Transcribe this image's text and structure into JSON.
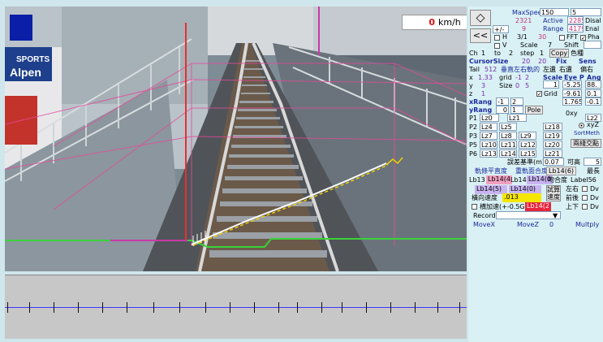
{
  "speed": {
    "value": "0",
    "unit": "km/h"
  },
  "signs": {
    "sports": "SPORTS",
    "alpen": "Alpen"
  },
  "panel": {
    "diamond_symbol": "◇",
    "rewind_symbol": "<<",
    "maxspeed_label": "MaxSpeed",
    "maxspeed_value": "150",
    "maxspeed_value2": "5",
    "active_label": "Active",
    "active_value": "2321",
    "active_value2": "2285",
    "disable_label": "Disal",
    "range_value": "9",
    "range_label": "Range",
    "range_value2": "4179",
    "enable_label": "Enal",
    "slash_label": "+/-",
    "h_label": "H",
    "fraction": "3/1",
    "fraction_value": "30",
    "fft_label": "FFT",
    "pha_label": "Pha",
    "v_label": "V",
    "scale_label": "Scale",
    "scale_value": "7",
    "shift_label": "Shift",
    "ch_label": "Ch",
    "ch_value": "1",
    "to_label": "to",
    "to_value": "2",
    "step_label": "step",
    "step_value": "1",
    "copy_label": "Copy",
    "shita_label": "色種",
    "cursorsize_label": "CursorSize",
    "cursorsize_v1": "20",
    "cursorsize_v2": "20",
    "fix_label": "Fix",
    "sens_label": "Sens",
    "tail_label": "Tail",
    "tail_value": "512",
    "jp_row": "垂直左右軌的",
    "left_label": "左遺",
    "right_label": "右遺",
    "kr_label": "偏右",
    "x_label": "x",
    "x_value": "1.33",
    "y_label": "y",
    "y_value": "3",
    "z_label": "z",
    "z_value": "1",
    "grid_label": "grid",
    "grid_v1": "-1",
    "grid_v2": "2",
    "size_label": "Size",
    "size_v1": "0",
    "size_v2": "5",
    "scale2_label": "Scale",
    "eyep_label": "Eye P",
    "ang_label": "Ang",
    "num_1": "1",
    "num_m525": "-5.25",
    "num_88": "88.",
    "grid_chk_label": "Grid",
    "num_m961": "-9.61",
    "num_01": "0.1",
    "num_1765": "1.765",
    "num_m01": "-0.1",
    "xrang_label": "xRang",
    "xrang_v1": "-1",
    "xrang_v2": "2",
    "yrang_label": "yRang",
    "yrang_v1": "0",
    "yrang_v2": "1",
    "pole_label": "Pole",
    "oxy_label": "0xy",
    "xyz_label": "xyZ",
    "sortm_label": "SortMeth",
    "p1": "P1",
    "p2": "P2",
    "p3": "P3",
    "p5": "P5",
    "p6": "P6",
    "lz0": "Lz0",
    "lz1": "Lz1",
    "lz4": "Lz4",
    "lz5": "Lz5",
    "lz18": "Lz18",
    "lz7": "Lz7",
    "lz8": "Lz8",
    "lz9": "Lz9",
    "lz19": "Lz19",
    "lz10": "Lz10",
    "lz11": "Lz11",
    "lz12": "Lz12",
    "lz20": "Lz20",
    "lz13": "Lz13",
    "lz14": "Lz14",
    "lz15": "Lz15",
    "lz21": "Lz21",
    "lz2": "Lz2",
    "jp_lr": "兩綫交點",
    "jp_range": "誤差基準(m)",
    "range_val": "0.07",
    "kakou_label": "可高",
    "kakou_value": "5",
    "jp_a": "軌條平直度",
    "jp_b": "重軌面合度",
    "lb14_6": "Lb14(6)",
    "jp_c": "最長",
    "lb13": "Lb13",
    "lb14_4": "Lb14(4",
    "lb14": "Lb14",
    "lb14_0": "Lb14(0",
    "jp_d": "吻合度",
    "label56": "Label56",
    "lb14_5": "Lb14(5)",
    "lb14_0b": "Lb14(0)",
    "jp_e": "試算速度",
    "jp_f": "左右",
    "jp_g": "前後",
    "jp_h": "上下",
    "jp_lat": "橫向速度",
    "lat_value": ".013",
    "jp_acc": "横加速(+-0.5G)",
    "lb14_2": "Lb14(2",
    "record_label": "Record",
    "movex_label": "MoveX",
    "movez_label": "MoveZ",
    "zero_label": "0",
    "multply_label": "Multply",
    "dv_label": "Dv"
  }
}
